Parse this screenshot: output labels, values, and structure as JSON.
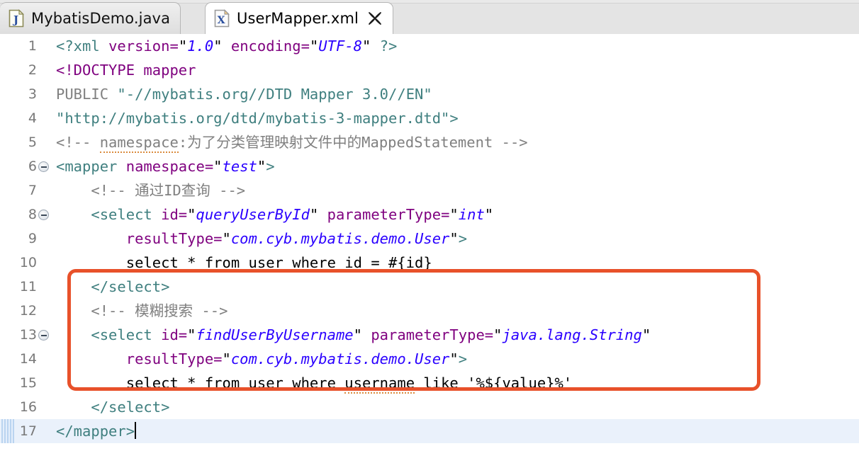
{
  "window": {
    "background_color": "#e9e9e9",
    "editor_background": "#ffffff"
  },
  "tabs": [
    {
      "label": "MybatisDemo.java",
      "icon": "java-file-icon",
      "active": false,
      "closable": false
    },
    {
      "label": "UserMapper.xml",
      "icon": "xml-file-icon",
      "active": true,
      "closable": true,
      "close_icon": "close-icon"
    }
  ],
  "editor": {
    "language": "xml",
    "caret_line": 17,
    "current_line_highlight_color": "#eaf1fb",
    "lines": [
      {
        "no": "1",
        "fold": false,
        "current": false
      },
      {
        "no": "2",
        "fold": false,
        "current": false
      },
      {
        "no": "3",
        "fold": false,
        "current": false
      },
      {
        "no": "4",
        "fold": false,
        "current": false
      },
      {
        "no": "5",
        "fold": false,
        "current": false
      },
      {
        "no": "6",
        "fold": true,
        "current": false
      },
      {
        "no": "7",
        "fold": false,
        "current": false
      },
      {
        "no": "8",
        "fold": true,
        "current": false
      },
      {
        "no": "9",
        "fold": false,
        "current": false
      },
      {
        "no": "10",
        "fold": false,
        "current": false
      },
      {
        "no": "11",
        "fold": false,
        "current": false
      },
      {
        "no": "12",
        "fold": false,
        "current": false
      },
      {
        "no": "13",
        "fold": true,
        "current": false
      },
      {
        "no": "14",
        "fold": false,
        "current": false
      },
      {
        "no": "15",
        "fold": false,
        "current": false
      },
      {
        "no": "16",
        "fold": false,
        "current": false
      },
      {
        "no": "17",
        "fold": false,
        "current": true
      }
    ],
    "text": {
      "l1_tag_open": "<?xml ",
      "l1_attr1": "version=",
      "l1_q1": "\"",
      "l1_val1": "1.0",
      "l1_q2": "\"",
      "l1_attr2": " encoding=",
      "l1_q3": "\"",
      "l1_val2": "UTF-8",
      "l1_q4": "\"",
      "l1_tag_close": " ?>",
      "l2": "<!DOCTYPE mapper",
      "l3_kw": "PUBLIC ",
      "l3_str": "\"-//mybatis.org//DTD Mapper 3.0//EN\"",
      "l4_str": "\"http://mybatis.org/dtd/mybatis-3-mapper.dtd\">",
      "l5_a": "<!-- ",
      "l5_spell": "namespace",
      "l5_b": ":为了分类管理映射文件中的MappedStatement -->",
      "l6_tag": "<mapper ",
      "l6_attr": "namespace=",
      "l6_q1": "\"",
      "l6_val": "test",
      "l6_q2": "\"",
      "l6_end": ">",
      "l7": "    <!-- 通过ID查询 -->",
      "l8_tag": "    <select ",
      "l8_attr1": "id=",
      "l8_q1": "\"",
      "l8_val1": "queryUserById",
      "l8_q2": "\"",
      "l8_attr2": " parameterType=",
      "l8_q3": "\"",
      "l8_val2": "int",
      "l8_q4": "\"",
      "l9_attr": "        resultType=",
      "l9_q1": "\"",
      "l9_val": "com.cyb.mybatis.demo.User",
      "l9_q2": "\"",
      "l9_end": ">",
      "l10": "        select * from user where id = #{id}",
      "l11": "    </select>",
      "l12": "    <!-- 模糊搜索 -->",
      "l13_tag": "    <select ",
      "l13_attr1": "id=",
      "l13_q1": "\"",
      "l13_val1": "findUserByUsername",
      "l13_q2": "\"",
      "l13_attr2": " parameterType=",
      "l13_q3": "\"",
      "l13_val2": "java.lang.String",
      "l13_q4": "\"",
      "l14_attr": "        resultType=",
      "l14_q1": "\"",
      "l14_val": "com.cyb.mybatis.demo.User",
      "l14_q2": "\"",
      "l14_end": ">",
      "l15_a": "        select * from user where ",
      "l15_spell": "username",
      "l15_b": " like '%${value}%'",
      "l16": "    </select>",
      "l17": "</mapper>"
    }
  },
  "annotation": {
    "type": "rectangle-highlight",
    "color": "#e8512a",
    "covers_lines": "12-16",
    "label": "highlight-box"
  }
}
